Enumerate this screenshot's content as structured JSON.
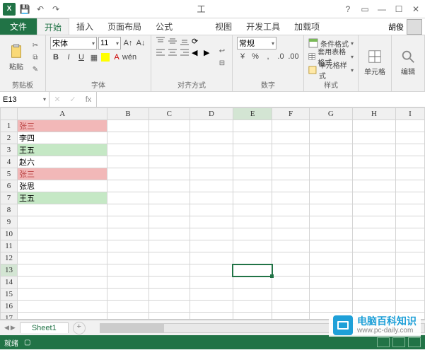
{
  "titlebar": {
    "center": "工"
  },
  "tabs": {
    "file": "文件",
    "items": [
      "开始",
      "插入",
      "页面布局",
      "公式",
      "",
      "视图",
      "开发工具",
      "加载项"
    ],
    "active_index": 0,
    "user": "胡俊"
  },
  "ribbon": {
    "clipboard": {
      "paste": "粘贴",
      "label": "剪贴板"
    },
    "font": {
      "name": "宋体",
      "size": "11",
      "label": "字体",
      "wen": "wén"
    },
    "alignment": {
      "label": "对齐方式"
    },
    "number": {
      "format": "常规",
      "label": "数字"
    },
    "styles": {
      "cond": "条件格式",
      "table": "套用表格格式",
      "cell": "单元格样式",
      "label": "样式"
    },
    "cells": {
      "label": "单元格"
    },
    "editing": {
      "label": "编辑"
    }
  },
  "formula_bar": {
    "name": "E13",
    "fx": "fx"
  },
  "grid": {
    "columns": [
      "A",
      "B",
      "C",
      "D",
      "E",
      "F",
      "G",
      "H",
      "I"
    ],
    "rows": 18,
    "selected": {
      "row": 13,
      "col": "E"
    },
    "cells": {
      "A1": {
        "v": "张三",
        "style": "hl-red"
      },
      "A2": {
        "v": "李四",
        "style": ""
      },
      "A3": {
        "v": "王五",
        "style": "hl-green"
      },
      "A4": {
        "v": "赵六",
        "style": ""
      },
      "A5": {
        "v": "张三",
        "style": "hl-red"
      },
      "A6": {
        "v": "张思",
        "style": ""
      },
      "A7": {
        "v": "王五",
        "style": "hl-green"
      }
    }
  },
  "sheets": {
    "active": "Sheet1"
  },
  "status": {
    "ready": "就绪"
  },
  "watermark": {
    "cn": "电脑百科知识",
    "url": "www.pc-daily.com"
  }
}
